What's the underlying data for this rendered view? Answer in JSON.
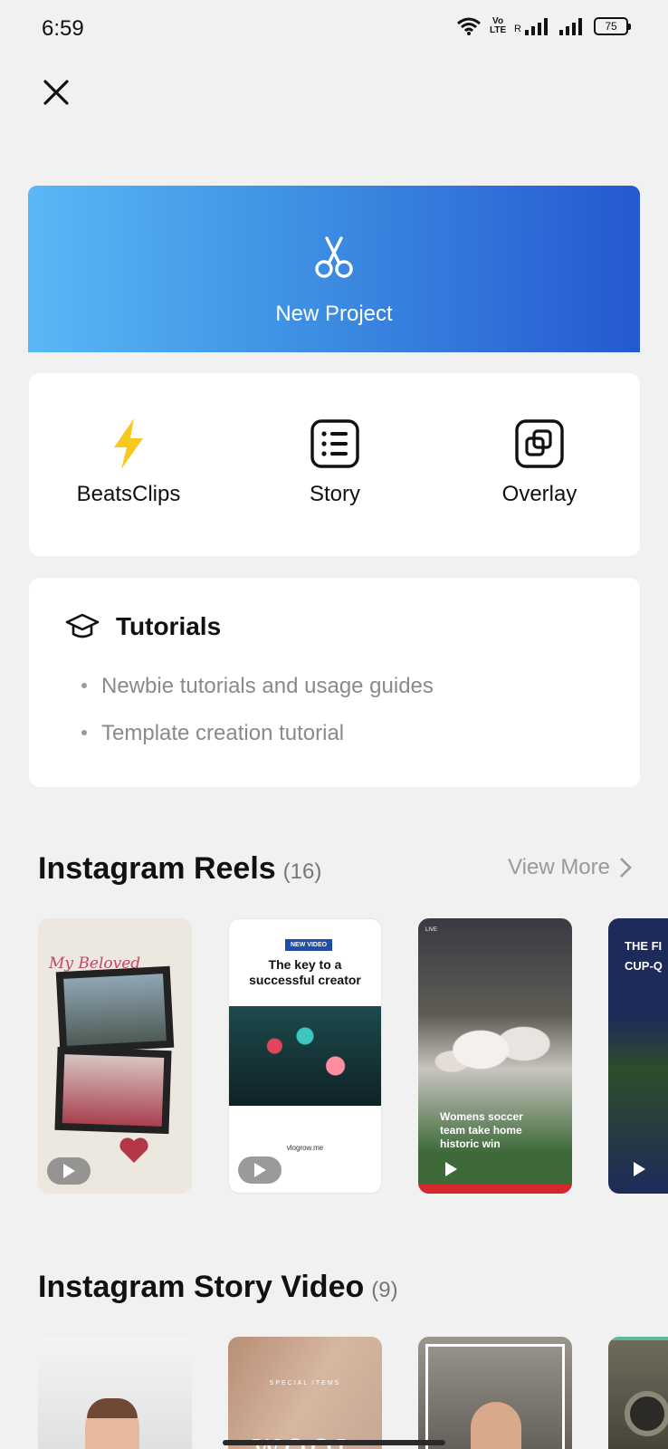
{
  "status_bar": {
    "time": "6:59",
    "network_label": "Vo LTE",
    "roaming": "R",
    "battery": "75"
  },
  "new_project": {
    "label": "New Project"
  },
  "quick_actions": [
    {
      "label": "BeatsClips",
      "icon": "lightning-icon"
    },
    {
      "label": "Story",
      "icon": "list-icon"
    },
    {
      "label": "Overlay",
      "icon": "overlay-icon"
    }
  ],
  "tutorials": {
    "title": "Tutorials",
    "items": [
      "Newbie tutorials and usage guides",
      "Template creation tutorial"
    ]
  },
  "reels": {
    "title": "Instagram Reels",
    "count": "(16)",
    "view_more": "View More",
    "thumbs": [
      {
        "script_title": "My Beloved"
      },
      {
        "badge": "NEW VIDEO",
        "headline": "The key to a successful creator",
        "footer": "vlogrow.me"
      },
      {
        "tag": "LIVE",
        "caption": "Womens soccer team take home historic win"
      },
      {
        "headline": "THE FI CUP-Q"
      }
    ]
  },
  "story": {
    "title": "Instagram Story Video",
    "count": "(9)",
    "thumbs": [
      {
        "text": ""
      },
      {
        "text": "SPECIAL ITEMS",
        "big_text": "WOOL"
      },
      {
        "text": ""
      },
      {
        "text": ""
      }
    ]
  },
  "colors": {
    "accent_start": "#5ab8f5",
    "accent_end": "#2459d0",
    "lightning": "#f7c81e"
  }
}
